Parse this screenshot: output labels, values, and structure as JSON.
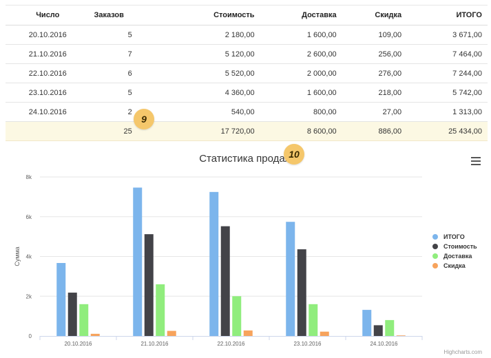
{
  "table": {
    "headers": [
      "Число",
      "Заказов",
      "Стоимость",
      "Доставка",
      "Скидка",
      "ИТОГО"
    ],
    "rows": [
      [
        "20.10.2016",
        "5",
        "2 180,00",
        "1 600,00",
        "109,00",
        "3 671,00"
      ],
      [
        "21.10.2016",
        "7",
        "5 120,00",
        "2 600,00",
        "256,00",
        "7 464,00"
      ],
      [
        "22.10.2016",
        "6",
        "5 520,00",
        "2 000,00",
        "276,00",
        "7 244,00"
      ],
      [
        "23.10.2016",
        "5",
        "4 360,00",
        "1 600,00",
        "218,00",
        "5 742,00"
      ],
      [
        "24.10.2016",
        "2",
        "540,00",
        "800,00",
        "27,00",
        "1 313,00"
      ]
    ],
    "total": [
      "",
      "25",
      "17 720,00",
      "8 600,00",
      "886,00",
      "25 434,00"
    ]
  },
  "badges": {
    "table_badge": "9",
    "chart_badge": "10"
  },
  "chart": {
    "title": "Статистика продаж",
    "credits": "Highcharts.com",
    "menu_icon": "hamburger-menu-icon"
  },
  "chart_data": {
    "type": "bar",
    "title": "Статистика продаж",
    "xlabel": "",
    "ylabel": "Сумма",
    "ylim": [
      0,
      8000
    ],
    "yticks": [
      "0",
      "2k",
      "4k",
      "6k",
      "8k"
    ],
    "categories": [
      "20.10.2016",
      "21.10.2016",
      "22.10.2016",
      "23.10.2016",
      "24.10.2016"
    ],
    "legend_position": "right",
    "series": [
      {
        "name": "ИТОГО",
        "color": "#7cb5ec",
        "values": [
          3671,
          7464,
          7244,
          5742,
          1313
        ]
      },
      {
        "name": "Стоимость",
        "color": "#434348",
        "values": [
          2180,
          5120,
          5520,
          4360,
          540
        ]
      },
      {
        "name": "Доставка",
        "color": "#90ed7d",
        "values": [
          1600,
          2600,
          2000,
          1600,
          800
        ]
      },
      {
        "name": "Скидка",
        "color": "#f7a35c",
        "values": [
          109,
          256,
          276,
          218,
          27
        ]
      }
    ]
  }
}
